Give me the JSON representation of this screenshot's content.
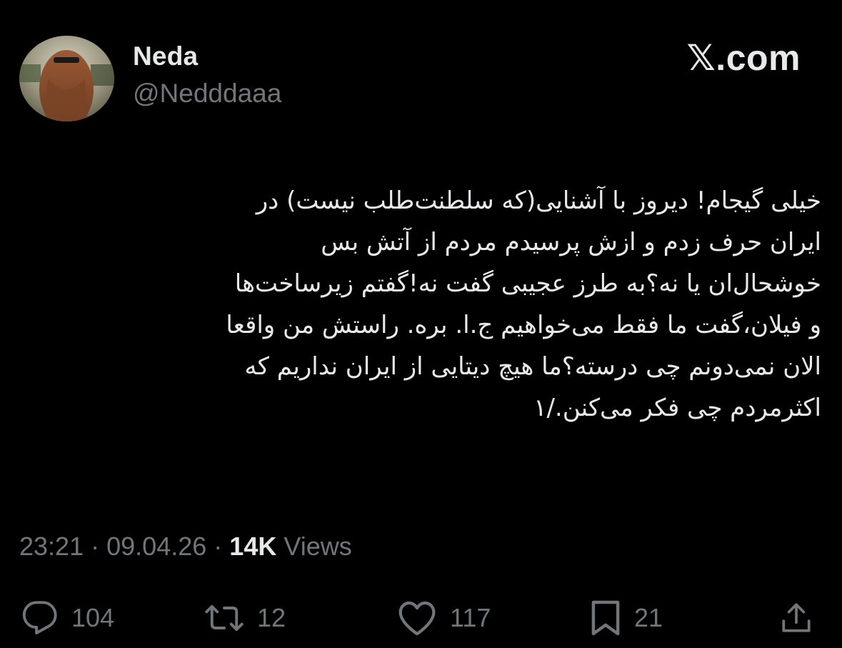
{
  "author": {
    "name": "Neda",
    "handle": "@Nedddaaa",
    "avatar_icon": "profile-photo"
  },
  "brand": "𝕏.com",
  "tweet": {
    "text": "خیلی گیجام! دیروز با آشنایی(که سلطنت‌طلب نیست) در\nایران حرف زدم و ازش پرسیدم مردم از آتش بس\nخوشحال‌ان یا نه؟به طرز عجیبی گفت نه!گفتم زیرساخت‌ها\nو فیلان،گفت ما فقط می‌خواهیم ج.ا. بره. راستش من واقعا\nالان نمی‌دونم چی درسته؟ما هیچ دیتایی از ایران نداریم که\nاکثرمردم چی فکر می‌کنن./۱"
  },
  "meta": {
    "time": "23:21",
    "date": "09.04.26",
    "views_count": "14K",
    "views_label": "Views",
    "separator": "·"
  },
  "actions": {
    "reply": {
      "icon": "reply-icon",
      "count": "104"
    },
    "repost": {
      "icon": "repost-icon",
      "count": "12"
    },
    "like": {
      "icon": "heart-icon",
      "count": "117"
    },
    "bookmark": {
      "icon": "bookmark-icon",
      "count": "21"
    },
    "share": {
      "icon": "share-icon"
    }
  },
  "colors": {
    "background": "#000000",
    "primary_text": "#e7e9ea",
    "secondary_text": "#71767b"
  }
}
